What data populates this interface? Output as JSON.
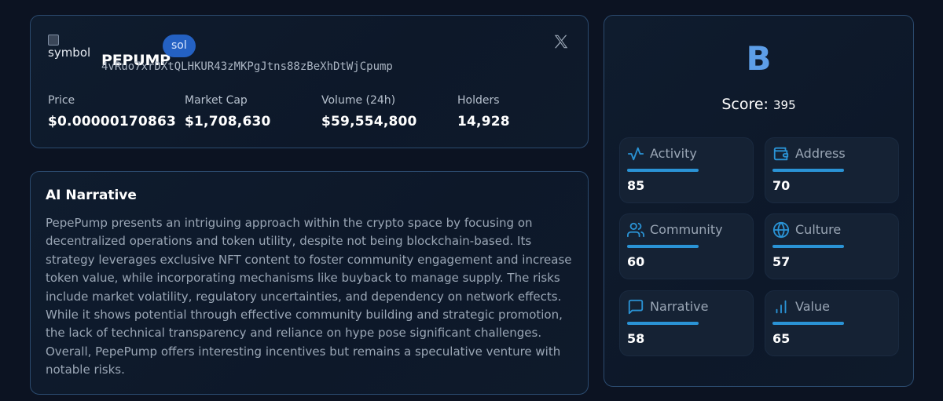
{
  "token": {
    "logo_alt": "symbol",
    "name": "PEPUMP",
    "chain": "sol",
    "address": "4vRuo7xrDXtQLHKUR43zMKPgJtns88zBeXhDtWjCpump",
    "social_icon": "x-logo-icon",
    "stats": [
      {
        "label": "Price",
        "value": "$0.00000170863"
      },
      {
        "label": "Market Cap",
        "value": "$1,708,630"
      },
      {
        "label": "Volume (24h)",
        "value": "$59,554,800"
      },
      {
        "label": "Holders",
        "value": "14,928"
      }
    ]
  },
  "narrative": {
    "title": "AI Narrative",
    "body": "PepePump presents an intriguing approach within the crypto space by focusing on decentralized operations and token utility, despite not being blockchain-based. Its strategy leverages exclusive NFT content to foster community engagement and increase token value, while incorporating mechanisms like buyback to manage supply. The risks include market volatility, regulatory uncertainties, and dependency on network effects. While it shows potential through effective community building and strategic promotion, the lack of technical transparency and reliance on hype pose significant challenges. Overall, PepePump offers interesting incentives but remains a speculative venture with notable risks."
  },
  "score": {
    "grade": "B",
    "label": "Score:",
    "value": "395",
    "metrics": [
      {
        "name": "Activity",
        "value": "85",
        "icon": "activity-icon"
      },
      {
        "name": "Address",
        "value": "70",
        "icon": "wallet-icon"
      },
      {
        "name": "Community",
        "value": "60",
        "icon": "users-icon"
      },
      {
        "name": "Culture",
        "value": "57",
        "icon": "globe-icon"
      },
      {
        "name": "Narrative",
        "value": "58",
        "icon": "message-square-icon"
      },
      {
        "name": "Value",
        "value": "65",
        "icon": "bar-chart-icon"
      }
    ]
  },
  "colors": {
    "background": "#0c1322",
    "card_border": "#2b4a6e",
    "accent_blue": "#5d9ee8",
    "chain_badge": "#2461c3",
    "metric_bar": "#2a93d5"
  }
}
